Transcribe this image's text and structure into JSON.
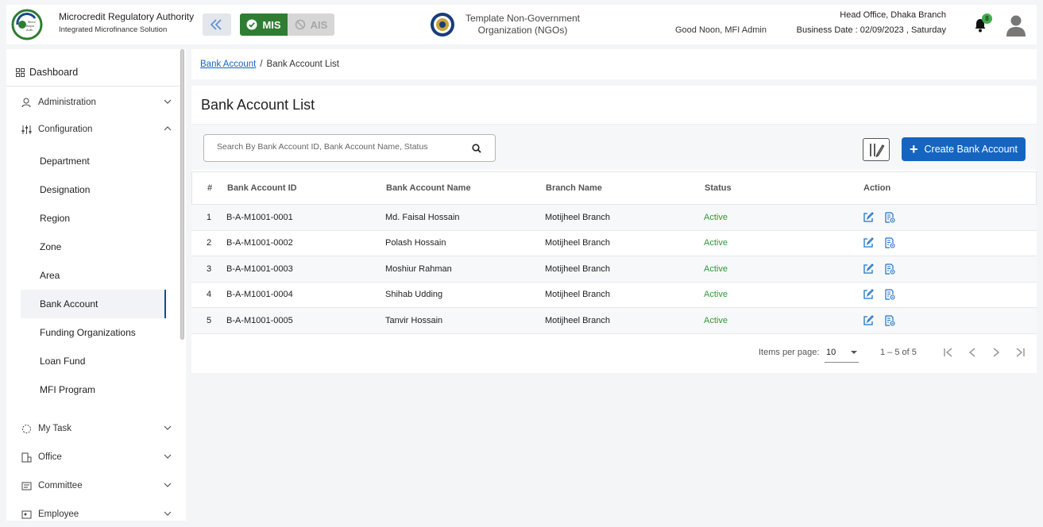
{
  "header": {
    "brand_title": "Microcredit Regulatory Authority",
    "brand_subtitle": "Integrated Microfinance Solution",
    "logo_text": "Microcredit Regulatory Authority",
    "mis_label": "MIS",
    "ais_label": "AIS",
    "org_name": "Template Non-Government Organization (NGOs)",
    "greeting": "Good Noon, MFI Admin",
    "branch": "Head Office, Dhaka Branch",
    "business_date": "Business Date : 02/09/2023 , Saturday",
    "notification_count": "8"
  },
  "sidebar": {
    "dashboard": "Dashboard",
    "menus": {
      "administration": "Administration",
      "configuration": "Configuration",
      "my_task": "My Task",
      "office": "Office",
      "committee": "Committee",
      "employee": "Employee"
    },
    "config_items": [
      "Department",
      "Designation",
      "Region",
      "Zone",
      "Area",
      "Bank Account",
      "Funding Organizations",
      "Loan Fund",
      "MFI Program"
    ],
    "active_item": "Bank Account"
  },
  "breadcrumb": {
    "parent": "Bank Account",
    "separator": "/",
    "current": "Bank Account List"
  },
  "main": {
    "title": "Bank Account List",
    "search_placeholder": "Search By Bank Account ID, Bank Account Name, Status",
    "create_label": "Create Bank Account"
  },
  "table": {
    "columns": {
      "num": "#",
      "id": "Bank Account ID",
      "name": "Bank Account Name",
      "branch": "Branch Name",
      "status": "Status",
      "action": "Action"
    },
    "rows": [
      {
        "num": "1",
        "id": "B-A-M1001-0001",
        "name": "Md. Faisal Hossain",
        "branch": "Motijheel Branch",
        "status": "Active"
      },
      {
        "num": "2",
        "id": "B-A-M1001-0002",
        "name": "Polash Hossain",
        "branch": "Motijheel Branch",
        "status": "Active"
      },
      {
        "num": "3",
        "id": "B-A-M1001-0003",
        "name": "Moshiur Rahman",
        "branch": "Motijheel Branch",
        "status": "Active"
      },
      {
        "num": "4",
        "id": "B-A-M1001-0004",
        "name": "Shihab Udding",
        "branch": "Motijheel Branch",
        "status": "Active"
      },
      {
        "num": "5",
        "id": "B-A-M1001-0005",
        "name": "Tanvir Hossain",
        "branch": "Motijheel Branch",
        "status": "Active"
      }
    ]
  },
  "paginator": {
    "items_per_page_label": "Items per page:",
    "items_per_page": "10",
    "range": "1 – 5 of 5"
  },
  "colors": {
    "primary": "#1565c0",
    "mis_green": "#2e7d32",
    "status_active": "#2e9a35",
    "badge": "#3fae49"
  }
}
